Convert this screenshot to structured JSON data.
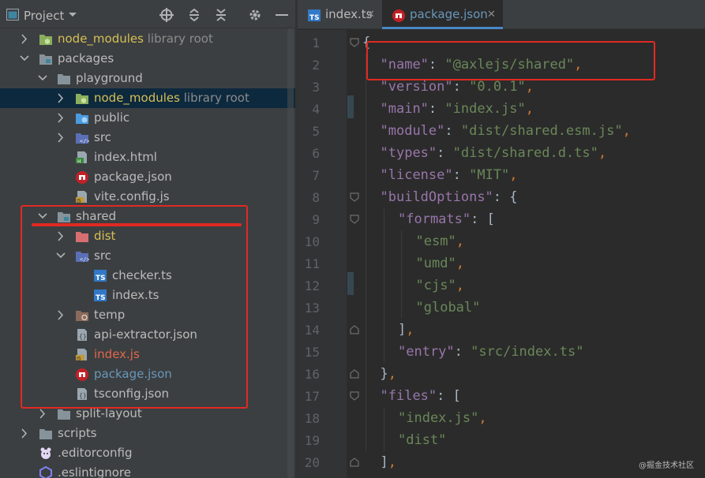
{
  "header": {
    "title": "Project"
  },
  "tree": [
    {
      "label": "node_modules",
      "suffix": "library root",
      "color": "#d6bf55",
      "chev": "right",
      "icon": "folder-nodejs-icon"
    },
    {
      "label": "packages",
      "suffix": "",
      "color": "#bbbbbb",
      "chev": "down",
      "icon": "folder-module-icon"
    },
    {
      "label": "playground",
      "suffix": "",
      "color": "#bbbbbb",
      "chev": "down",
      "icon": "folder-icon"
    },
    {
      "label": "node_modules",
      "suffix": "library root",
      "color": "#d6bf55",
      "chev": "right",
      "icon": "folder-nodejs-icon"
    },
    {
      "label": "public",
      "suffix": "",
      "color": "#bbbbbb",
      "chev": "right",
      "icon": "folder-web-icon"
    },
    {
      "label": "src",
      "suffix": "",
      "color": "#bbbbbb",
      "chev": "right",
      "icon": "folder-source-icon"
    },
    {
      "label": "index.html",
      "suffix": "",
      "color": "#bbbbbb",
      "chev": "",
      "icon": "html-file-icon"
    },
    {
      "label": "package.json",
      "suffix": "",
      "color": "#bbbbbb",
      "chev": "",
      "icon": "npm-file-icon"
    },
    {
      "label": "vite.config.js",
      "suffix": "",
      "color": "#bbbbbb",
      "chev": "",
      "icon": "js-config-file-icon"
    },
    {
      "label": "shared",
      "suffix": "",
      "color": "#bbbbbb",
      "chev": "down",
      "icon": "folder-module-icon"
    },
    {
      "label": "dist",
      "suffix": "",
      "color": "#d6bf55",
      "chev": "right",
      "icon": "folder-excluded-icon"
    },
    {
      "label": "src",
      "suffix": "",
      "color": "#bbbbbb",
      "chev": "down",
      "icon": "folder-source-icon"
    },
    {
      "label": "checker.ts",
      "suffix": "",
      "color": "#bbbbbb",
      "chev": "",
      "icon": "ts-file-icon"
    },
    {
      "label": "index.ts",
      "suffix": "",
      "color": "#bbbbbb",
      "chev": "",
      "icon": "ts-file-icon"
    },
    {
      "label": "temp",
      "suffix": "",
      "color": "#bbbbbb",
      "chev": "right",
      "icon": "folder-temp-icon"
    },
    {
      "label": "api-extractor.json",
      "suffix": "",
      "color": "#bbbbbb",
      "chev": "",
      "icon": "json-file-icon"
    },
    {
      "label": "index.js",
      "suffix": "",
      "color": "#e0674c",
      "chev": "",
      "icon": "js-file-icon"
    },
    {
      "label": "package.json",
      "suffix": "",
      "color": "#6897bb",
      "chev": "",
      "icon": "npm-file-icon"
    },
    {
      "label": "tsconfig.json",
      "suffix": "",
      "color": "#bbbbbb",
      "chev": "",
      "icon": "json-file-icon"
    },
    {
      "label": "split-layout",
      "suffix": "",
      "color": "#bbbbbb",
      "chev": "right",
      "icon": "folder-icon"
    },
    {
      "label": "scripts",
      "suffix": "",
      "color": "#bbbbbb",
      "chev": "right",
      "icon": "folder-icon"
    },
    {
      "label": ".editorconfig",
      "suffix": "",
      "color": "#bbbbbb",
      "chev": "",
      "icon": "editorconfig-file-icon"
    },
    {
      "label": ".eslintignore",
      "suffix": "",
      "color": "#bbbbbb",
      "chev": "",
      "icon": "eslint-file-icon"
    }
  ],
  "tabs": [
    {
      "label": "index.ts",
      "close": "✕",
      "icon": "ts-file-icon"
    },
    {
      "label": "package.json",
      "close": "✕",
      "icon": "npm-file-icon"
    }
  ],
  "code": [
    [
      [
        "br",
        "{"
      ]
    ],
    [
      [
        "k",
        "\"name\""
      ],
      [
        "br",
        ": "
      ],
      [
        "s",
        "\"@axlejs/shared\""
      ],
      [
        "p",
        ","
      ]
    ],
    [
      [
        "k",
        "\"version\""
      ],
      [
        "br",
        ": "
      ],
      [
        "s",
        "\"0.0.1\""
      ],
      [
        "p",
        ","
      ]
    ],
    [
      [
        "k",
        "\"main\""
      ],
      [
        "br",
        ": "
      ],
      [
        "s",
        "\"index.js\""
      ],
      [
        "p",
        ","
      ]
    ],
    [
      [
        "k",
        "\"module\""
      ],
      [
        "br",
        ": "
      ],
      [
        "s",
        "\"dist/shared.esm.js\""
      ],
      [
        "p",
        ","
      ]
    ],
    [
      [
        "k",
        "\"types\""
      ],
      [
        "br",
        ": "
      ],
      [
        "s",
        "\"dist/shared.d.ts\""
      ],
      [
        "p",
        ","
      ]
    ],
    [
      [
        "k",
        "\"license\""
      ],
      [
        "br",
        ": "
      ],
      [
        "s",
        "\"MIT\""
      ],
      [
        "p",
        ","
      ]
    ],
    [
      [
        "k",
        "\"buildOptions\""
      ],
      [
        "br",
        ": {"
      ]
    ],
    [
      [
        "k",
        "\"formats\""
      ],
      [
        "br",
        ": ["
      ]
    ],
    [
      [
        "s",
        "\"esm\""
      ],
      [
        "p",
        ","
      ]
    ],
    [
      [
        "s",
        "\"umd\""
      ],
      [
        "p",
        ","
      ]
    ],
    [
      [
        "s",
        "\"cjs\""
      ],
      [
        "p",
        ","
      ]
    ],
    [
      [
        "s",
        "\"global\""
      ]
    ],
    [
      [
        "br",
        "]"
      ],
      [
        "p",
        ","
      ]
    ],
    [
      [
        "k",
        "\"entry\""
      ],
      [
        "br",
        ": "
      ],
      [
        "s",
        "\"src/index.ts\""
      ]
    ],
    [
      [
        "br",
        "}"
      ],
      [
        "p",
        ","
      ]
    ],
    [
      [
        "k",
        "\"files\""
      ],
      [
        "br",
        ": ["
      ]
    ],
    [
      [
        "s",
        "\"index.js\""
      ],
      [
        "p",
        ","
      ]
    ],
    [
      [
        "s",
        "\"dist\""
      ]
    ],
    [
      [
        "br",
        "]"
      ],
      [
        "p",
        ","
      ]
    ]
  ],
  "line_numbers": [
    "1",
    "2",
    "3",
    "4",
    "5",
    "6",
    "7",
    "8",
    "9",
    "10",
    "11",
    "12",
    "13",
    "14",
    "15",
    "16",
    "17",
    "18",
    "19",
    "20"
  ],
  "watermark": "@掘金技术社区",
  "colors": {
    "accent": "#e02a23",
    "selection": "#0d293e",
    "tab_underline": "#4a88c7"
  }
}
